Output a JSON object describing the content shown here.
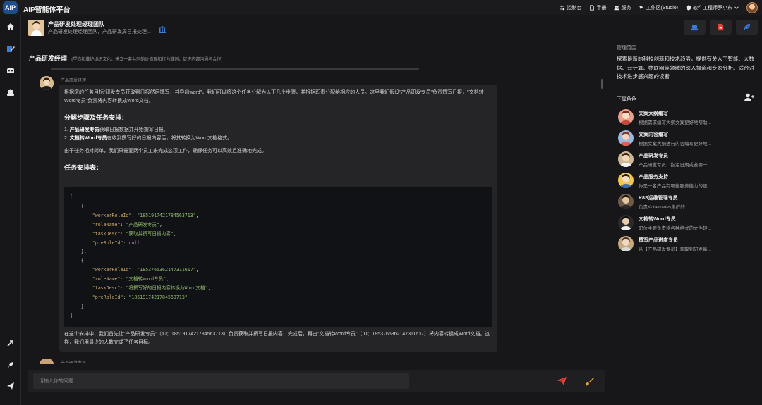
{
  "app": {
    "logo": "AIP",
    "title": "AIP智能体平台"
  },
  "topnav": [
    {
      "label": "控制台",
      "icon": "sliders-icon"
    },
    {
      "label": "手册",
      "icon": "document-icon"
    },
    {
      "label": "服务",
      "icon": "users-icon"
    },
    {
      "label": "工作区(Studio)",
      "icon": "cursor-icon"
    },
    {
      "label": "软件工程师罗小东",
      "icon": "shield-icon"
    }
  ],
  "agent": {
    "name": "产品研发处理经理团队",
    "desc": "产品研发处理经理团队，产品研发周日报处理..."
  },
  "section": {
    "title": "产品研发经理",
    "subtitle": "(塑造和维护组织文化，建立一套共同的价值观和行为准则，促进内部沟通与合作)"
  },
  "message": {
    "sender": "产品研发经理",
    "intro": "根据您的任务目标\"研发专员获取到日报然后撰写，并导出word\"，我们可以将这个任务分解为以下几个步骤，并根据职责分配给相应的人员。这里我们假设\"产品研发专员\"负责撰写日报，\"文档转Word专员\"负责将内容转换成Word文档。",
    "h1": "分解步骤及任务安排：",
    "step1_role": "产品研发专员",
    "step1_text": "获取日报数据并开始撰写日报。",
    "step2_role": "文档转Word专员",
    "step2_text": "在收到撰写好的日报内容后，将其转换为Word文档格式。",
    "note": "由于任务相对简单，我们只需要两个员工来完成这项工作，确保任务可以高效且准确地完成。",
    "h2": "任务安排表：",
    "tasks": [
      {
        "workerRoleId": "\"1851917421784563713\"",
        "roleName": "\"产品研发专员\"",
        "taskDesc": "\"获取并撰写日报内容\"",
        "preRoleId": "null"
      },
      {
        "workerRoleId": "\"1853765362147311617\"",
        "roleName": "\"文档转Word专员\"",
        "taskDesc": "\"将撰写好的日报内容转换为Word文档\"",
        "preRoleId": "\"1851917421784563713\""
      }
    ],
    "summary": "在这个安排中，我们首先让\"产品研发专员\"（ID：1851917421784563713）负责获取并撰写日报内容，完成后，再由\"文档转Word专员\"（ID：1853765362147311617）将内容转换成Word文档。这样，我们用最少的人数完成了任务目标。",
    "next_sender": "产品研发专员"
  },
  "input": {
    "placeholder": "请输入你的问题."
  },
  "panel": {
    "title": "管理范围",
    "desc": "探索最新的科技创新和技术趋势，提供有关人工智能、大数据、云计算、物联网等领域的深入报道和专家分析。适合对技术进步感兴趣的读者",
    "sub_title": "下属角色",
    "roles": [
      {
        "name": "文案大纲编写",
        "desc": "根据需求编写大纲文案更好地帮助..."
      },
      {
        "name": "文案内容编写",
        "desc": "根据文案大纲进行内容编写更好地..."
      },
      {
        "name": "产品研发专员",
        "desc": "产品研发专员，指定日期或者哪一..."
      },
      {
        "name": "产品服务支持",
        "desc": "你是一名产品有哪些服务能力的还..."
      },
      {
        "name": "K8S运维管理专员",
        "desc": "负责Kubernetes集群的..."
      },
      {
        "name": "文档转Word专员",
        "desc": "职位主要负责将各种格式的文件转..."
      },
      {
        "name": "撰写产品进度专员",
        "desc": "从【产品研发专员】获取到研发每..."
      }
    ]
  },
  "colors": {
    "accent_blue": "#3b7bdc",
    "accent_red": "#e0423a",
    "accent_orange": "#e8a23a"
  }
}
